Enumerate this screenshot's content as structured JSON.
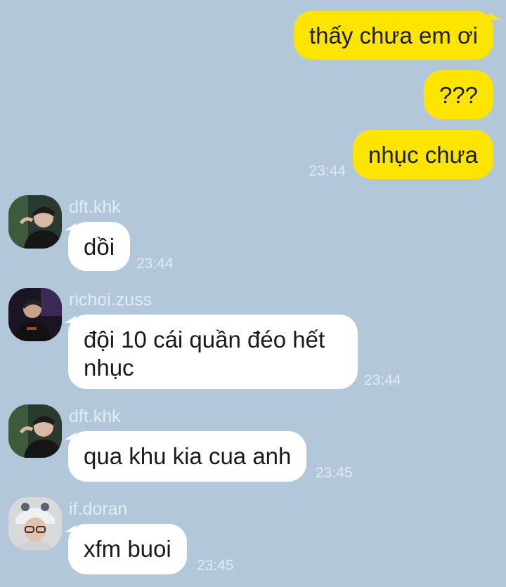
{
  "outgoing": [
    {
      "text": "thấy chưa em ơi"
    },
    {
      "text": "???"
    },
    {
      "text": "nhục chưa",
      "time": "23:44"
    }
  ],
  "incoming": [
    {
      "sender": "dft.khk",
      "avatar_icon": "person-avatar-icon",
      "text": "dồi",
      "time": "23:44"
    },
    {
      "sender": "richoi.zuss",
      "avatar_icon": "person-avatar-icon",
      "text": "đội 10 cái quần đéo hết nhục",
      "time": "23:44"
    },
    {
      "sender": "dft.khk",
      "avatar_icon": "person-avatar-icon",
      "text": "qua khu kia cua anh",
      "time": "23:45"
    },
    {
      "sender": "if.doran",
      "avatar_icon": "person-avatar-icon",
      "text": "xfm buoi",
      "time": "23:45"
    }
  ],
  "colors": {
    "background": "#b2c7da",
    "outgoing_bubble": "#fee500",
    "incoming_bubble": "#ffffff"
  }
}
